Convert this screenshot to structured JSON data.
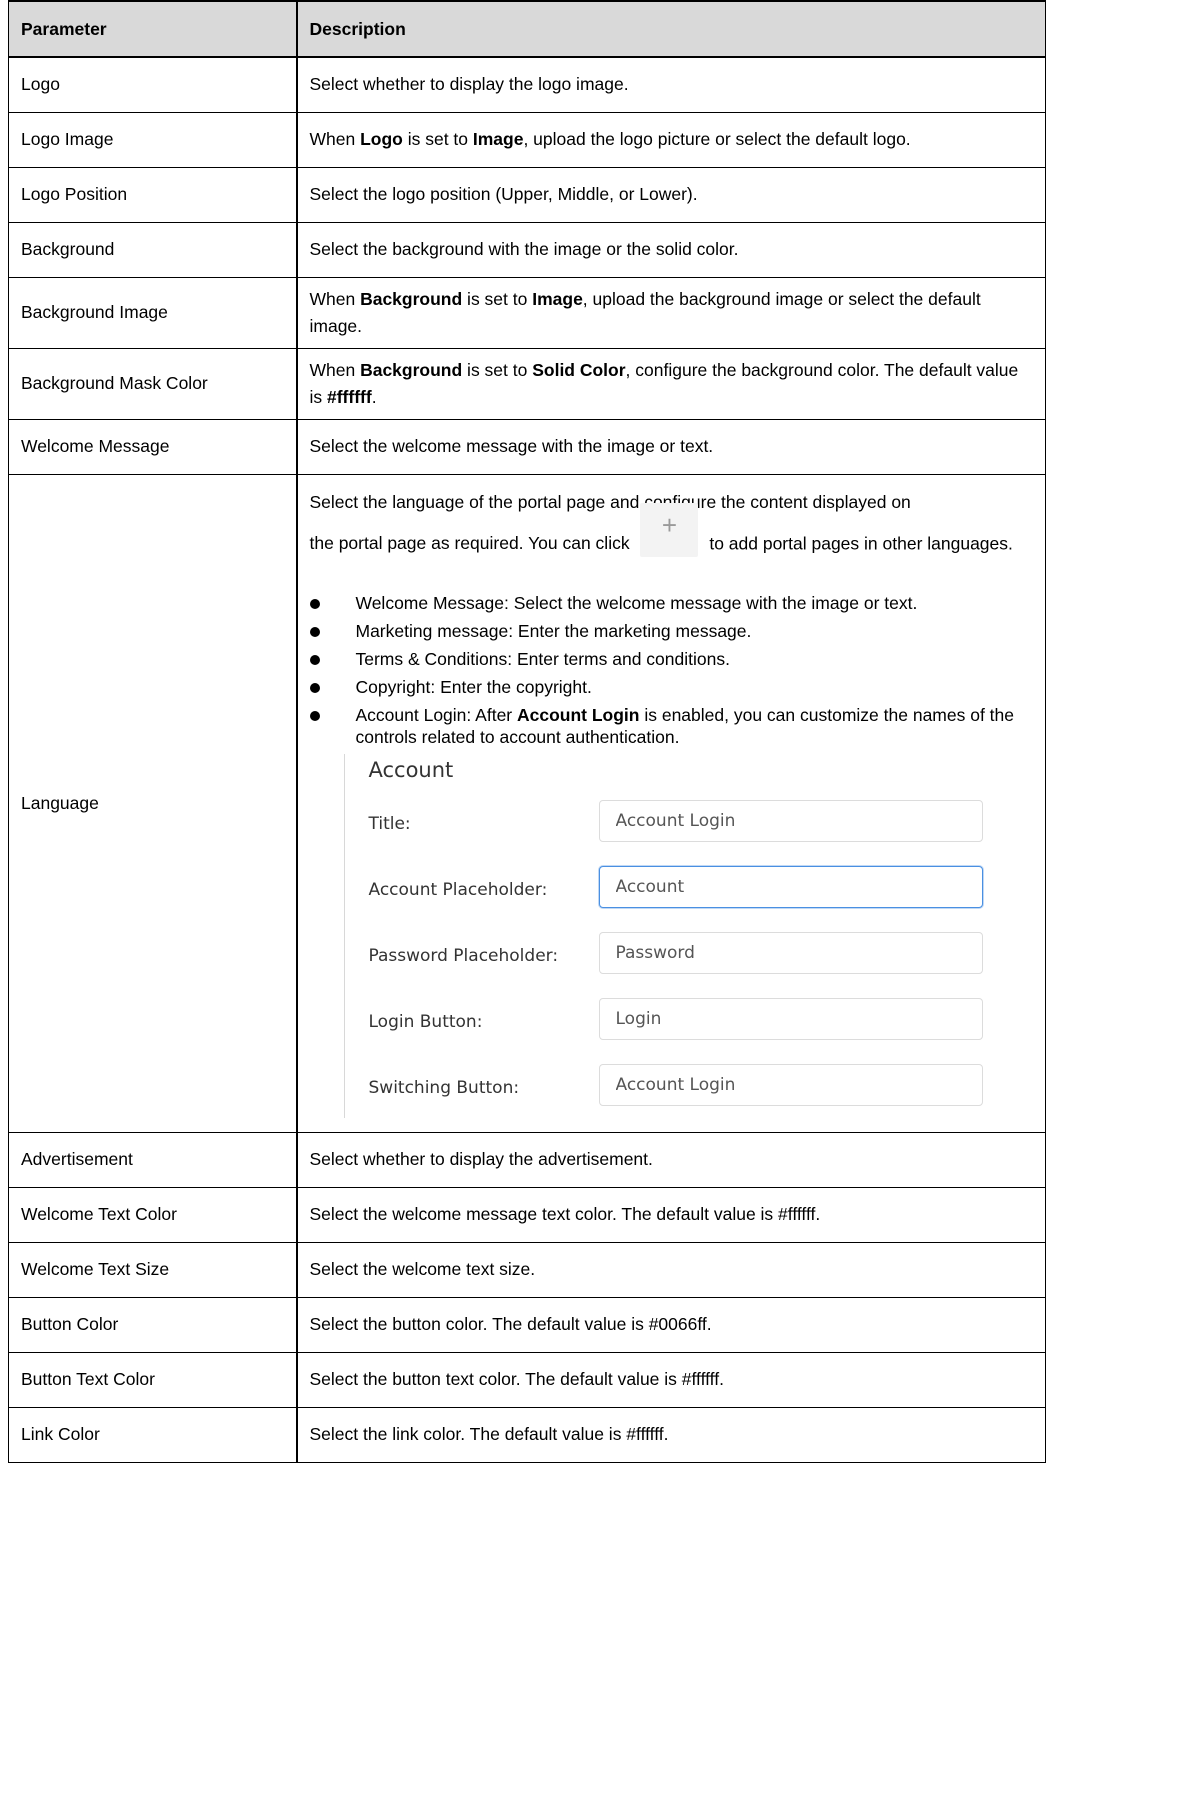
{
  "table": {
    "headers": {
      "parameter": "Parameter",
      "description": "Description"
    },
    "rows": [
      {
        "param": "Logo",
        "desc": [
          "Select whether to display the logo image."
        ]
      },
      {
        "param": "Logo Image",
        "desc": [
          "When ",
          "Logo",
          " is set to ",
          "Image",
          ", upload the logo picture or select the default logo."
        ]
      },
      {
        "param": "Logo Position",
        "desc": [
          "Select the logo position (Upper, Middle, or Lower)."
        ]
      },
      {
        "param": "Background",
        "desc": [
          "Select the background with the image or the solid color."
        ]
      },
      {
        "param": "Background Image",
        "desc": [
          "When ",
          "Background",
          " is set to ",
          "Image",
          ", upload the background image or select the default image."
        ]
      },
      {
        "param": "Background Mask Color",
        "desc": [
          "When ",
          "Background",
          " is set to ",
          "Solid Color",
          ", configure the background color. The default value is ",
          "#ffffff",
          "."
        ]
      },
      {
        "param": "Welcome Message",
        "desc": [
          "Select the welcome message with the image or text."
        ]
      },
      {
        "param": "Language"
      },
      {
        "param": "Advertisement",
        "desc": [
          "Select whether to display the advertisement."
        ]
      },
      {
        "param": "Welcome Text Color",
        "desc": [
          "Select the welcome message text color. The default value is #ffffff."
        ]
      },
      {
        "param": "Welcome Text Size",
        "desc": [
          "Select the welcome text size."
        ]
      },
      {
        "param": "Button Color",
        "desc": [
          "Select the button color. The default value is #0066ff."
        ]
      },
      {
        "param": "Button Text Color",
        "desc": [
          "Select the button text color. The default value is #ffffff."
        ]
      },
      {
        "param": "Link Color",
        "desc": [
          "Select the link color. The default value is #ffffff."
        ]
      }
    ]
  },
  "language": {
    "intro_part1": "Select the language of the portal page and configure the content displayed on the portal page as required. You can click",
    "plus_icon": "+",
    "intro_part2": "to add portal pages in other languages.",
    "bullets": [
      "Welcome Message: Select the welcome message with the image or text.",
      "Marketing message: Enter the marketing message.",
      "Terms & Conditions: Enter terms and conditions.",
      "Copyright: Enter the copyright."
    ],
    "account_bullet": {
      "before": "Account Login: After ",
      "bold": "Account Login",
      "after": " is enabled, you can customize the names of the controls related to account authentication."
    },
    "account_panel": {
      "title": "Account",
      "fields": [
        {
          "label": "Title:",
          "value": "Account Login",
          "focused": false
        },
        {
          "label": "Account Placeholder:",
          "value": "Account",
          "focused": true
        },
        {
          "label": "Password Placeholder:",
          "value": "Password",
          "focused": false
        },
        {
          "label": "Login Button:",
          "value": "Login",
          "focused": false
        },
        {
          "label": "Switching Button:",
          "value": "Account Login",
          "focused": false
        }
      ]
    }
  },
  "colors": {
    "header_bg": "#d9d9d9",
    "focus_border": "#4a90e2"
  }
}
